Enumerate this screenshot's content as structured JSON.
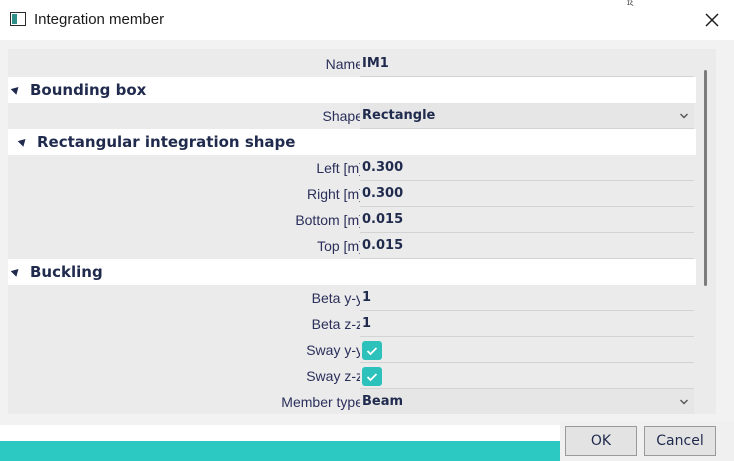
{
  "window": {
    "title": "Integration member",
    "top_mark": "ɪξ"
  },
  "name_row": {
    "label": "Name",
    "value": "IM1"
  },
  "bounding_box": {
    "title": "Bounding box",
    "shape": {
      "label": "Shape",
      "value": "Rectangle"
    }
  },
  "rect_shape": {
    "title": "Rectangular integration shape",
    "rows": [
      {
        "label": "Left [m]",
        "value": "0.300"
      },
      {
        "label": "Right [m]",
        "value": "0.300"
      },
      {
        "label": "Bottom [m]",
        "value": "0.015"
      },
      {
        "label": "Top [m]",
        "value": "0.015"
      }
    ]
  },
  "buckling": {
    "title": "Buckling",
    "beta_yy": {
      "label": "Beta y-y",
      "value": "1"
    },
    "beta_zz": {
      "label": "Beta z-z",
      "value": "1"
    },
    "sway_yy": {
      "label": "Sway y-y",
      "checked": true
    },
    "sway_zz": {
      "label": "Sway z-z",
      "checked": true
    },
    "member_type": {
      "label": "Member type",
      "value": "Beam"
    }
  },
  "buttons": {
    "ok": "OK",
    "cancel": "Cancel"
  },
  "colors": {
    "accent": "#2cc9c2",
    "checkbox": "#2cc2bb",
    "text": "#1f2a4d"
  },
  "icons": {
    "close": "close-icon",
    "collapse": "collapse-triangle-icon",
    "dropdown": "chevron-down-icon",
    "check": "checkmark-icon"
  }
}
